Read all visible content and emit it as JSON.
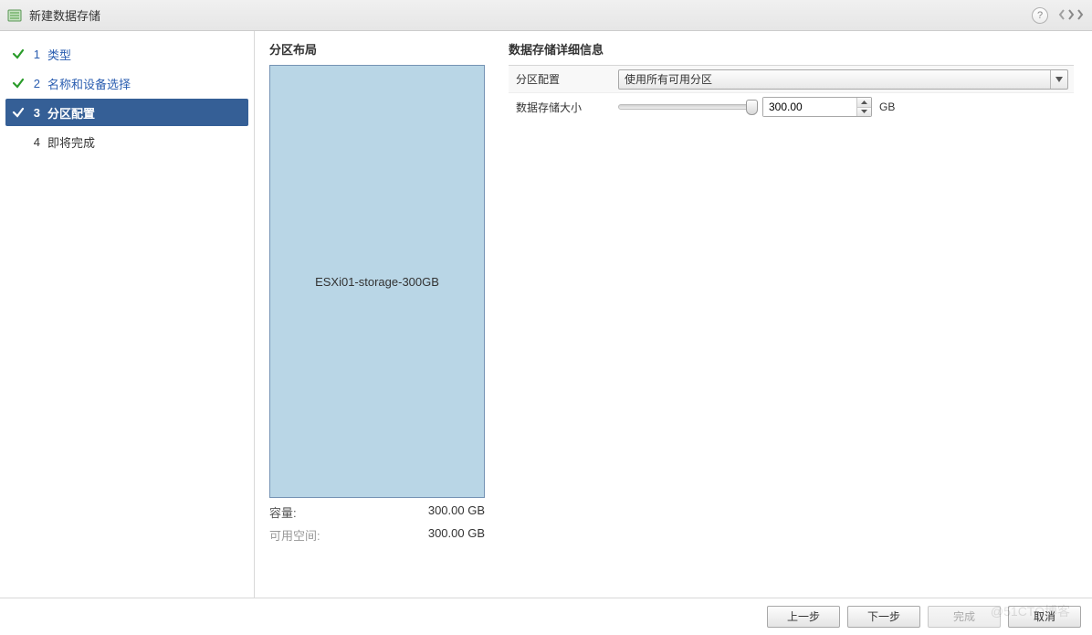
{
  "titlebar": {
    "title": "新建数据存储",
    "help_tooltip": "?"
  },
  "steps": [
    {
      "num": "1",
      "label": "类型",
      "state": "completed"
    },
    {
      "num": "2",
      "label": "名称和设备选择",
      "state": "completed"
    },
    {
      "num": "3",
      "label": "分区配置",
      "state": "active"
    },
    {
      "num": "4",
      "label": "即将完成",
      "state": "upcoming"
    }
  ],
  "partition_layout": {
    "title": "分区布局",
    "block_label": "ESXi01-storage-300GB",
    "capacity_label": "容量:",
    "capacity_value": "300.00 GB",
    "freespace_label": "可用空间:",
    "freespace_value": "300.00 GB"
  },
  "details": {
    "title": "数据存储详细信息",
    "partition_config_label": "分区配置",
    "partition_config_value": "使用所有可用分区",
    "datastore_size_label": "数据存储大小",
    "datastore_size_value": "300.00",
    "datastore_size_unit": "GB"
  },
  "footer": {
    "back": "上一步",
    "next": "下一步",
    "finish": "完成",
    "cancel": "取消"
  },
  "watermark": "@51CTO博客"
}
